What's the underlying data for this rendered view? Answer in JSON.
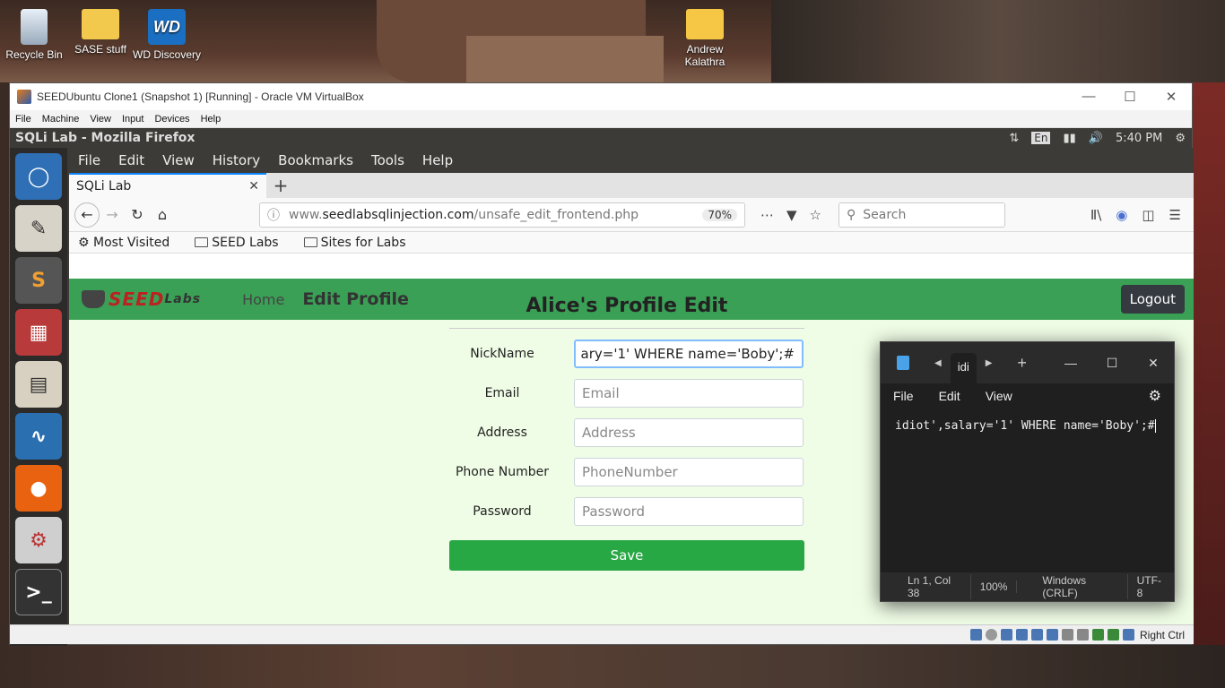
{
  "desktop": {
    "icons": [
      {
        "label": "Recycle Bin"
      },
      {
        "label": "SASE stuff"
      },
      {
        "label": "WD Discovery"
      },
      {
        "label": "Andrew Kalathra"
      }
    ]
  },
  "vbox": {
    "title": "SEEDUbuntu Clone1 (Snapshot 1) [Running] - Oracle VM VirtualBox",
    "menu": [
      "File",
      "Machine",
      "View",
      "Input",
      "Devices",
      "Help"
    ],
    "status_host_key": "Right Ctrl"
  },
  "guest_panel": {
    "title": "SQLi Lab - Mozilla Firefox",
    "lang": "En",
    "time": "5:40 PM"
  },
  "firefox": {
    "menu": [
      "File",
      "Edit",
      "View",
      "History",
      "Bookmarks",
      "Tools",
      "Help"
    ],
    "tab_title": "SQLi Lab",
    "url_prefix": "www.",
    "url_host": "seedlabsqlinjection.com",
    "url_path": "/unsafe_edit_frontend.php",
    "zoom": "70%",
    "search_placeholder": "Search",
    "bookmarks": [
      "Most Visited",
      "SEED Labs",
      "Sites for Labs"
    ]
  },
  "page": {
    "logo_main": "SEED",
    "logo_sub": "Labs",
    "nav_home": "Home",
    "nav_edit": "Edit Profile",
    "logout": "Logout",
    "form_title": "Alice's Profile Edit",
    "fields": [
      {
        "label": "NickName",
        "value": "ary='1' WHERE name='Boby';#",
        "placeholder": ""
      },
      {
        "label": "Email",
        "value": "",
        "placeholder": "Email"
      },
      {
        "label": "Address",
        "value": "",
        "placeholder": "Address"
      },
      {
        "label": "Phone Number",
        "value": "",
        "placeholder": "PhoneNumber"
      },
      {
        "label": "Password",
        "value": "",
        "placeholder": "Password"
      }
    ],
    "save_label": "Save"
  },
  "notepad": {
    "tab_title": "idi",
    "menu": [
      "File",
      "Edit",
      "View"
    ],
    "content": "idiot',salary='1' WHERE name='Boby';#",
    "status": [
      "Ln 1, Col 38",
      "100%",
      "Windows (CRLF)",
      "UTF-8"
    ]
  }
}
